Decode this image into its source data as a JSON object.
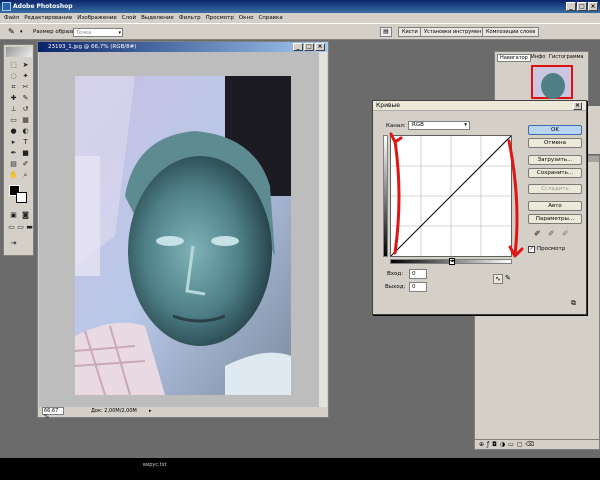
{
  "app": {
    "title": "Adobe Photoshop"
  },
  "menu": [
    "Файл",
    "Редактирование",
    "Изображение",
    "Слой",
    "Выделение",
    "Фильтр",
    "Просмотр",
    "Окно",
    "Справка"
  ],
  "options": {
    "sample_size_label": "Размер образца:",
    "sample_size_value": "Точка"
  },
  "palette_tabs": [
    "Кисти",
    "Установки инструментов",
    "Композиции слоев"
  ],
  "document": {
    "title": "23193_1.jpg @ 66,7% (RGB/8#)",
    "zoom": "66,67 %",
    "doc_info": "Док: 2,00M/2,00M"
  },
  "curves": {
    "title": "Кривые",
    "channel_label": "Канал:",
    "channel_value": "RGB",
    "input_label": "Вход:",
    "input_value": "0",
    "output_label": "Выход:",
    "output_value": "0",
    "preview_label": "Просмотр",
    "buttons": {
      "ok": "OK",
      "cancel": "Отмена",
      "load": "Загрузить...",
      "save": "Сохранить...",
      "smooth": "Сгладить",
      "auto": "Авто",
      "options": "Параметры..."
    }
  },
  "navigator": {
    "tabs": [
      "Навигатор",
      "Инфо",
      "Гистограмма"
    ]
  },
  "taskbar": {
    "item": "вирус.txt"
  },
  "colors": {
    "annotation": "#e21515",
    "title_bar": "#0a246a",
    "chrome": "#d4d0c8"
  }
}
